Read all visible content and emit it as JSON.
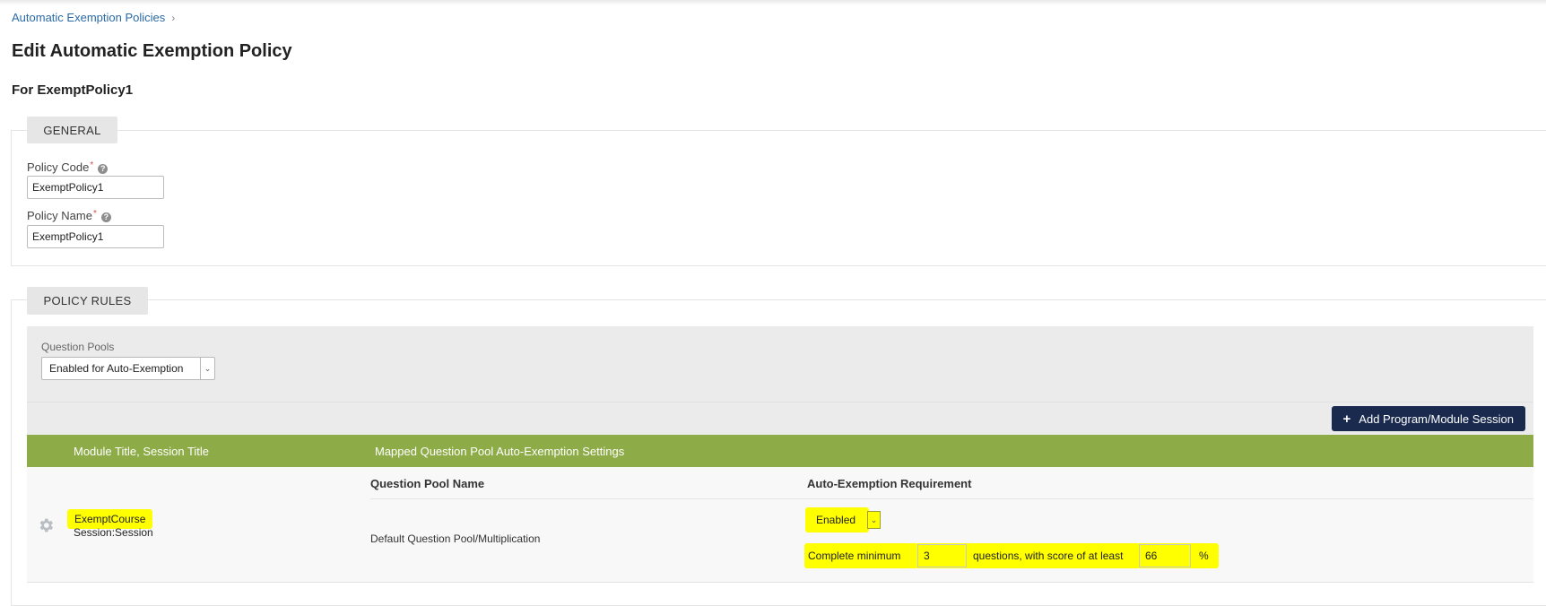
{
  "breadcrumb": {
    "link": "Automatic Exemption Policies",
    "separator": "›"
  },
  "page": {
    "title": "Edit Automatic Exemption Policy",
    "subtitle": "For ExemptPolicy1"
  },
  "general": {
    "legend": "GENERAL",
    "policy_code": {
      "label": "Policy Code",
      "required_mark": "*",
      "value": "ExemptPolicy1"
    },
    "policy_name": {
      "label": "Policy Name",
      "required_mark": "*",
      "value": "ExemptPolicy1"
    }
  },
  "rules": {
    "legend": "POLICY RULES",
    "question_pools_label": "Question Pools",
    "question_pools_value": "Enabled for Auto-Exemption",
    "add_button": "Add Program/Module Session",
    "table": {
      "col_module": "Module Title, Session Title",
      "col_settings": "Mapped Question Pool Auto-Exemption Settings",
      "sub_col_pool": "Question Pool Name",
      "sub_col_requirement": "Auto-Exemption Requirement"
    },
    "rows": [
      {
        "course": "ExemptCourse",
        "session": "Session:Session",
        "pool_name": "Default Question Pool/Multiplication",
        "requirement_status": "Enabled",
        "criteria_prefix": "Complete minimum",
        "min_questions": "3",
        "criteria_middle": "questions, with score of at least",
        "min_score": "66",
        "criteria_suffix": "%"
      }
    ]
  },
  "colors": {
    "accent_green": "#8dab47",
    "button_navy": "#1a2a4f",
    "highlight": "#ffff00",
    "link_blue": "#2a6aa6"
  },
  "icons": [
    "help-icon",
    "chevron-down-icon",
    "plus-icon",
    "gear-icon"
  ]
}
